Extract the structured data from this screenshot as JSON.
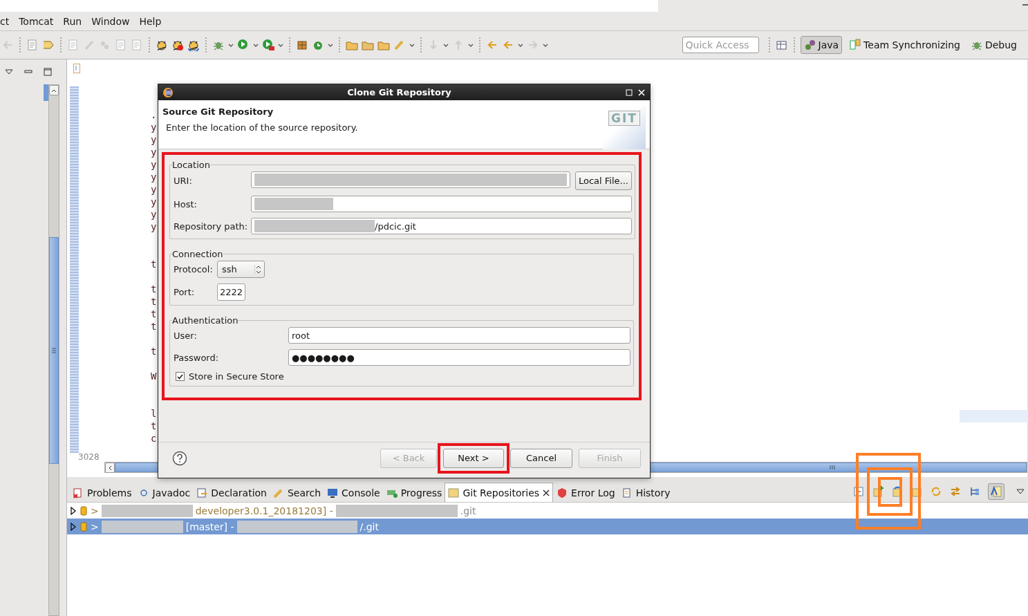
{
  "menu": [
    "ct",
    "Tomcat",
    "Run",
    "Window",
    "Help"
  ],
  "quick_access": {
    "placeholder": "Quick Access"
  },
  "perspectives": [
    {
      "label": "Java",
      "selected": true
    },
    {
      "label": "Team Synchronizing",
      "selected": false
    },
    {
      "label": "Debug",
      "selected": false
    }
  ],
  "editor": {
    "line_groups": [
      [
        ".",
        "y",
        "y",
        "y",
        "y",
        "y",
        "y",
        "y",
        "y",
        "y"
      ],
      [
        "t"
      ],
      [
        "t",
        "t",
        "t",
        "t"
      ],
      [
        "t"
      ],
      [
        "W"
      ],
      [
        "l",
        "t",
        "c"
      ]
    ],
    "line_count": "3028"
  },
  "dialog": {
    "title": "Clone Git Repository",
    "heading": "Source Git Repository",
    "description": "Enter the location of the source repository.",
    "logo_text": "GIT",
    "groups": [
      {
        "legend": "Location",
        "fields": [
          {
            "kind": "text",
            "label": "URI:",
            "redacted": true,
            "button": "Local File..."
          },
          {
            "kind": "text",
            "label": "Host:",
            "redacted": true
          },
          {
            "kind": "text",
            "label": "Repository path:",
            "redacted": true,
            "value": "/pdcic.git"
          }
        ]
      },
      {
        "legend": "Connection",
        "fields": [
          {
            "kind": "select",
            "label": "Protocol:",
            "value": "ssh"
          },
          {
            "kind": "short",
            "label": "Port:",
            "value": "2222"
          }
        ]
      },
      {
        "legend": "Authentication",
        "fields": [
          {
            "kind": "text",
            "label": "User:",
            "value": "root"
          },
          {
            "kind": "text",
            "label": "Password:",
            "value": "●●●●●●●●"
          },
          {
            "kind": "checkbox",
            "label": "Store in Secure Store",
            "checked": true
          }
        ]
      }
    ],
    "buttons": [
      {
        "label": "< Back",
        "disabled": true,
        "highlighted": false
      },
      {
        "label": "Next >",
        "disabled": false,
        "highlighted": true
      },
      {
        "label": "Cancel",
        "disabled": false,
        "highlighted": false
      },
      {
        "label": "Finish",
        "disabled": true,
        "highlighted": false
      }
    ]
  },
  "bottom_tabs": [
    {
      "label": "Problems",
      "selected": false
    },
    {
      "label": "Javadoc",
      "selected": false
    },
    {
      "label": "Declaration",
      "selected": false
    },
    {
      "label": "Search",
      "selected": false
    },
    {
      "label": "Console",
      "selected": false
    },
    {
      "label": "Progress",
      "selected": false
    },
    {
      "label": "Git Repositories",
      "selected": true
    },
    {
      "label": "Error Log",
      "selected": false
    },
    {
      "label": "History",
      "selected": false
    }
  ],
  "repositories": [
    {
      "prefix": ">",
      "text": "developer3.0.1_20181203] -",
      "suffix": ".git",
      "selected": false
    },
    {
      "prefix": ">",
      "text": "[master] -",
      "suffix": "/.git",
      "selected": true
    }
  ]
}
